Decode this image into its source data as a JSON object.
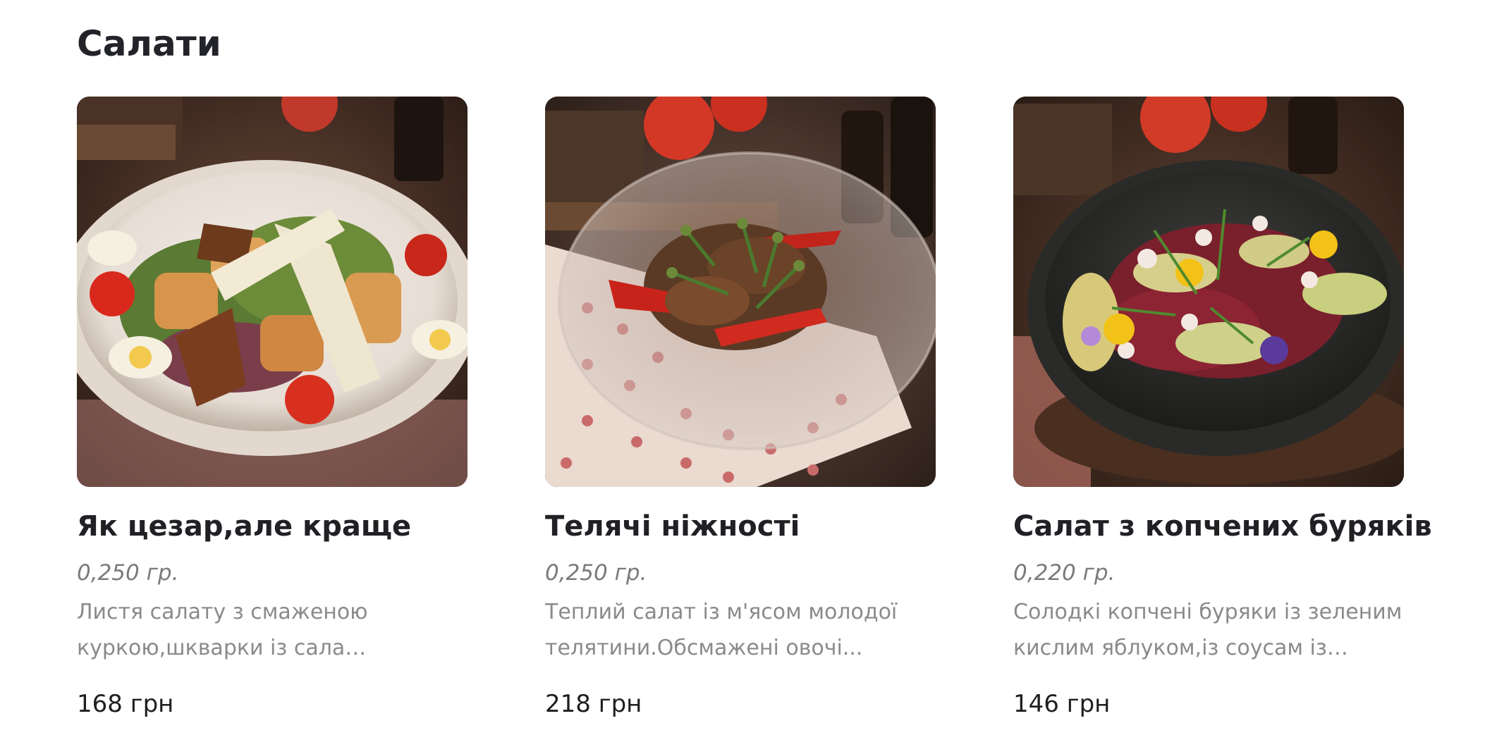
{
  "section": {
    "title": "Салати"
  },
  "cards": [
    {
      "name": "Як цезар,але краще",
      "weight": "0,250 гр.",
      "description": "Листя салату з смаженою куркою,шкварки із сала власного...",
      "price": "168 грн",
      "image": "caesar-salad-photo"
    },
    {
      "name": "Телячі ніжності",
      "weight": "0,250 гр.",
      "description": "Теплий салат із м'ясом молодої телятини.Обсмажені овочі...",
      "price": "218 грн",
      "image": "veal-salad-photo"
    },
    {
      "name": "Салат з копчених буряків",
      "weight": "0,220 гр.",
      "description": "Солодкі копчені буряки із зеленим кислим яблуком,із соусам із сира...",
      "price": "146 грн",
      "image": "smoked-beet-salad-photo"
    }
  ]
}
